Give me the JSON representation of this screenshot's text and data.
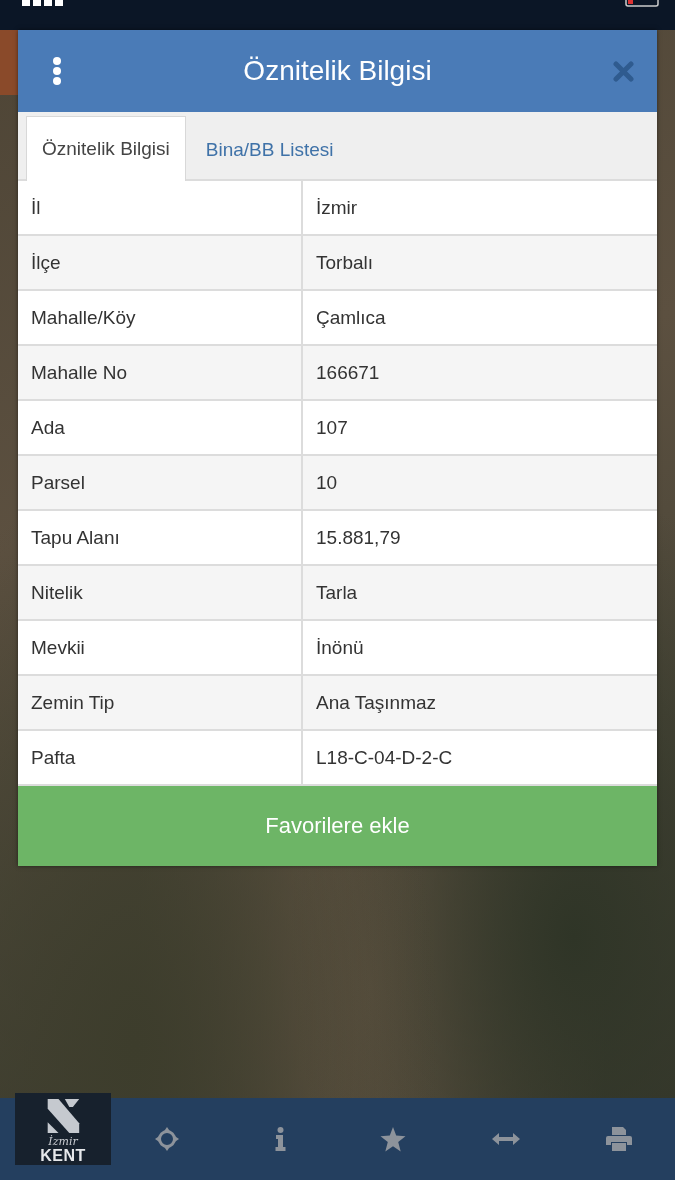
{
  "dialog": {
    "title": "Öznitelik Bilgisi"
  },
  "tabs": [
    {
      "label": "Öznitelik Bilgisi",
      "selected": true
    },
    {
      "label": "Bina/BB Listesi",
      "selected": false
    }
  ],
  "table": {
    "rows": [
      {
        "label": "İl",
        "value": "İzmir"
      },
      {
        "label": "İlçe",
        "value": "Torbalı"
      },
      {
        "label": "Mahalle/Köy",
        "value": "Çamlıca"
      },
      {
        "label": "Mahalle No",
        "value": "166671"
      },
      {
        "label": "Ada",
        "value": "107"
      },
      {
        "label": "Parsel",
        "value": "10"
      },
      {
        "label": "Tapu Alanı",
        "value": "15.881,79"
      },
      {
        "label": "Nitelik",
        "value": "Tarla"
      },
      {
        "label": "Mevkii",
        "value": "İnönü"
      },
      {
        "label": "Zemin Tip",
        "value": "Ana Taşınmaz"
      },
      {
        "label": "Pafta",
        "value": "L18-C-04-D-2-C"
      }
    ]
  },
  "button": {
    "label": "Favorilere ekle"
  },
  "toolbar": {
    "logo": {
      "script": "İzmir",
      "wordmark": "KENT"
    }
  }
}
